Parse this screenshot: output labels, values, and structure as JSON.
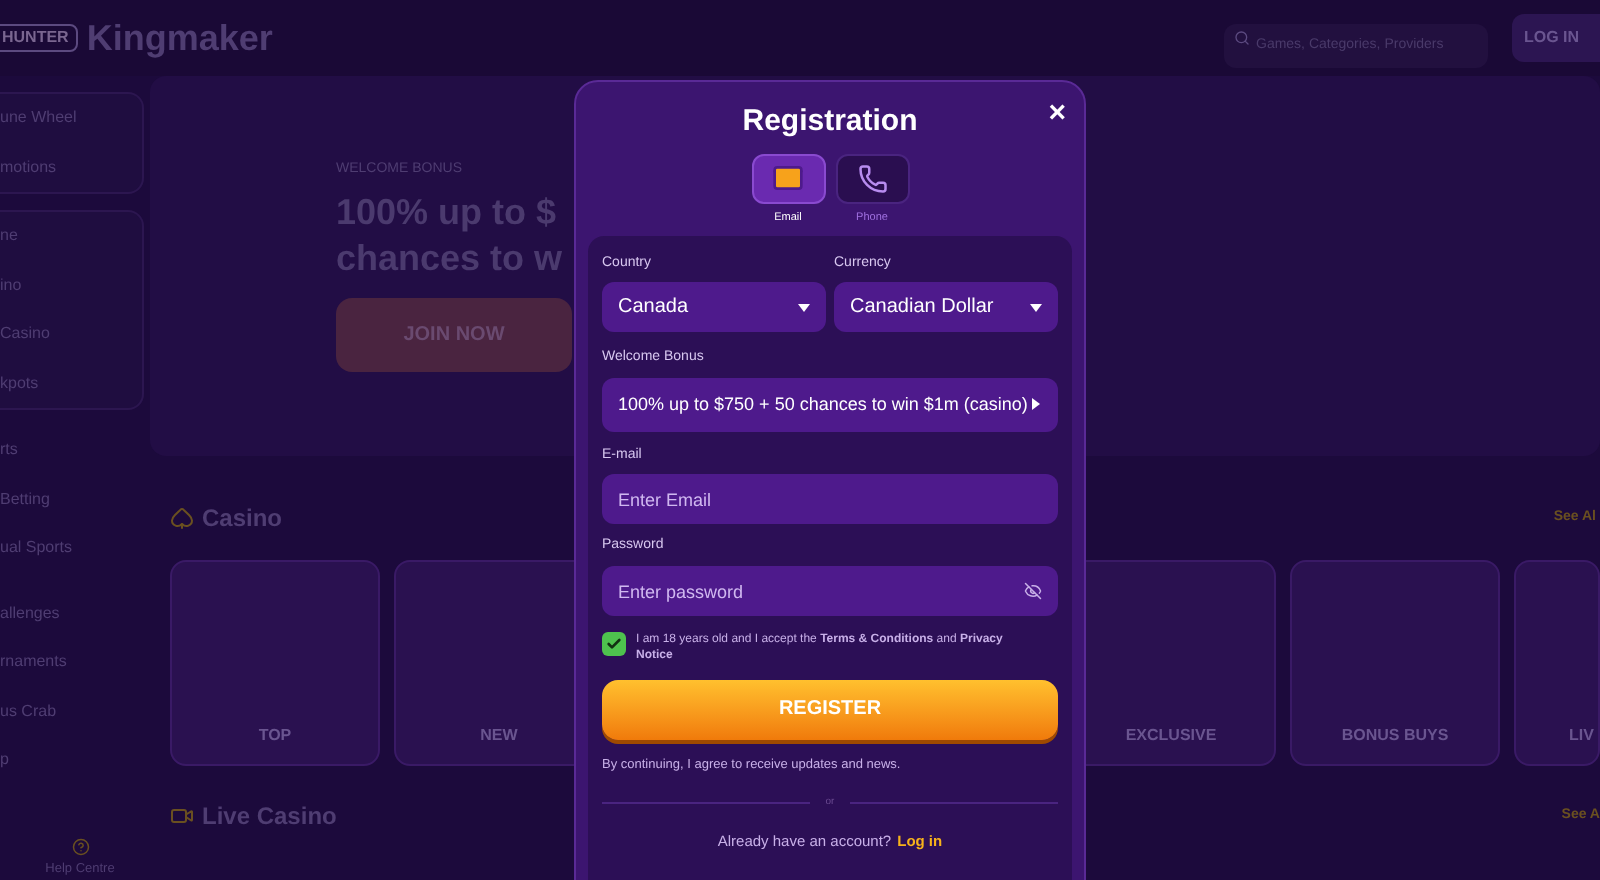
{
  "header": {
    "logo_badge": "HUNTER",
    "brand": "Kingmaker",
    "search": {
      "placeholder": "Games, Categories, Providers"
    },
    "login": "LOG IN"
  },
  "sidebar": {
    "groups": [
      [
        "une Wheel",
        "motions"
      ],
      [
        "ne",
        "ino",
        "Casino",
        "kpots"
      ],
      [
        "rts",
        "Betting",
        "ual Sports"
      ],
      [
        "allenges",
        "rnaments",
        "us Crab",
        "p"
      ]
    ],
    "help": "Help Centre"
  },
  "hero": {
    "eyebrow": "WELCOME BONUS",
    "headline": [
      "100% up to $",
      "chances to w"
    ],
    "cta": "JOIN NOW"
  },
  "casino": {
    "title": "Casino",
    "see_all": "See Al",
    "cards": [
      {
        "label": "TOP"
      },
      {
        "label": "NEW"
      },
      {
        "label": "EXCLUSIVE"
      },
      {
        "label": "BONUS BUYS"
      },
      {
        "label": "LIV"
      }
    ]
  },
  "live_casino": {
    "title": "Live Casino",
    "see_all": "See A"
  },
  "modal": {
    "title": "Registration",
    "close": "×",
    "methods": [
      {
        "kind": "email",
        "label": "Email",
        "selected": true
      },
      {
        "kind": "phone",
        "label": "Phone",
        "selected": false
      }
    ],
    "country": {
      "label": "Country",
      "value": "Canada"
    },
    "currency": {
      "label": "Currency",
      "value": "Canadian Dollar"
    },
    "bonus": {
      "label": "Welcome Bonus",
      "value": "100% up to $750 + 50 chances to win $1m (casino)"
    },
    "email": {
      "label": "E-mail",
      "placeholder": "Enter Email"
    },
    "password": {
      "label": "Password",
      "placeholder": "Enter password"
    },
    "consent": {
      "checked": true,
      "text": "I am 18 years old and I accept the **Terms & Conditions** and **Privacy Notice**"
    },
    "register": "REGISTER",
    "note": "By continuing, I agree to receive updates and news.",
    "divider": "or",
    "login_prompt": "Already have an account?",
    "login_link": "Log in"
  }
}
